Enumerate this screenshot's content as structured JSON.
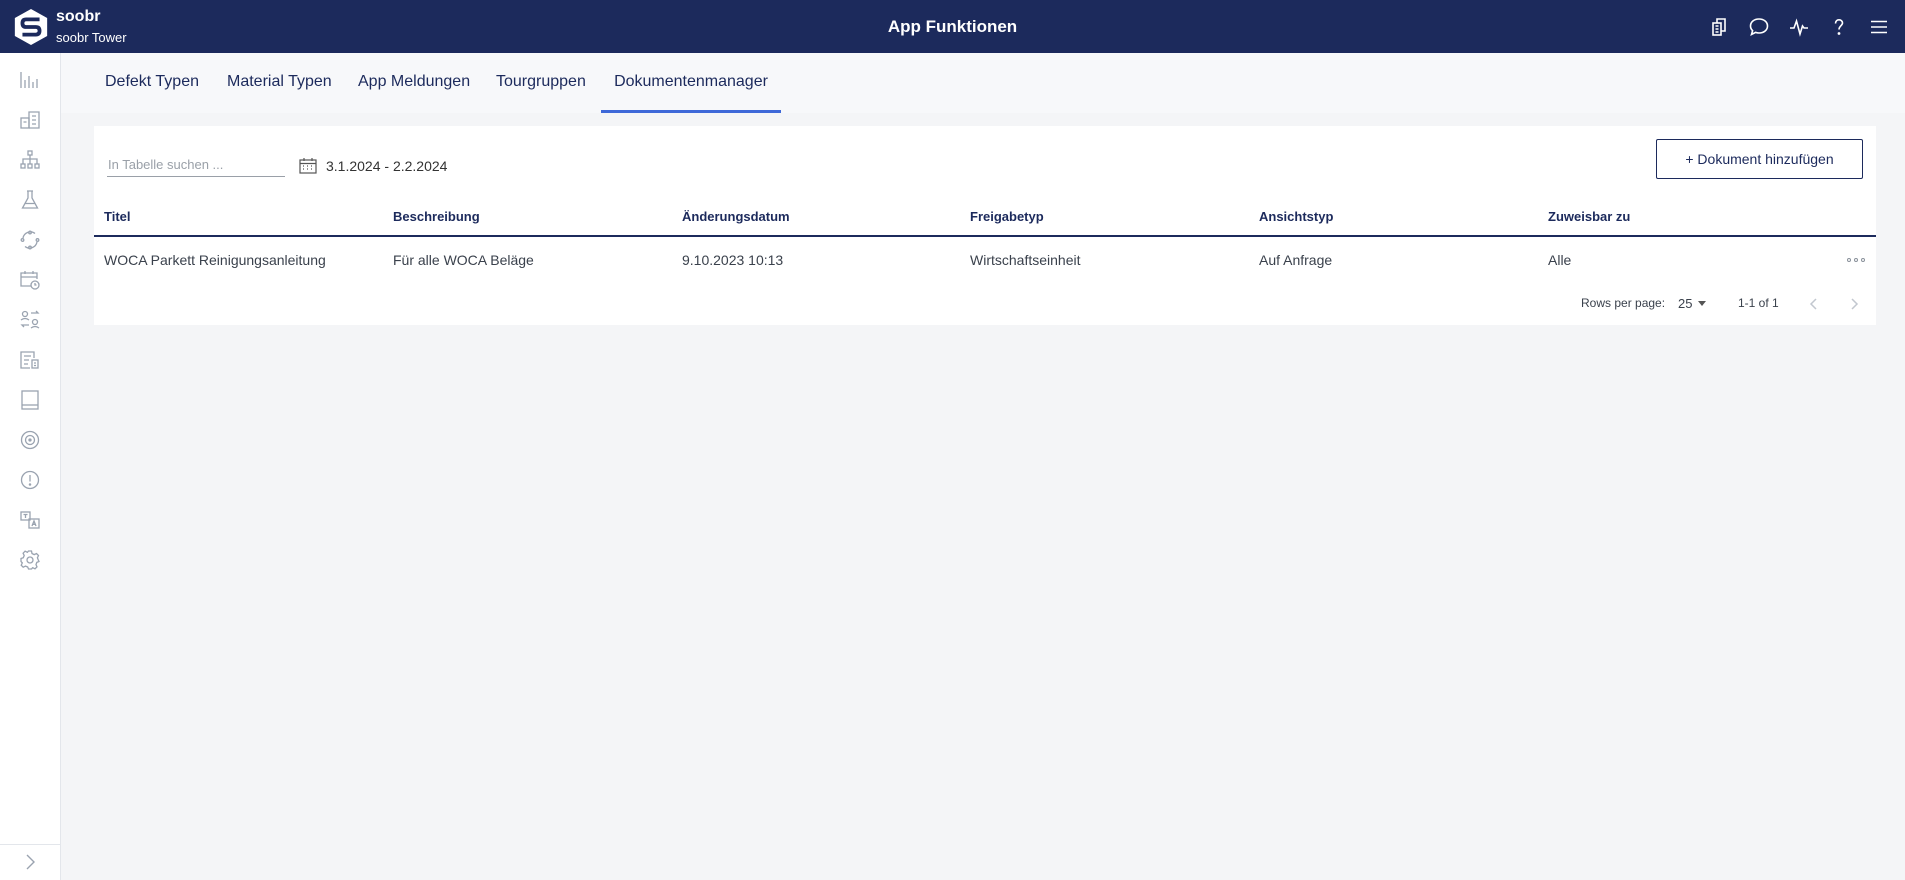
{
  "header": {
    "brand_name": "soobr",
    "brand_sub": "soobr Tower",
    "title": "App Funktionen",
    "icons": [
      "buildings-icon",
      "chat-icon",
      "activity-icon",
      "help-icon",
      "menu-icon"
    ]
  },
  "sidebar": {
    "items": [
      "analytics-icon",
      "buildings-icon",
      "hierarchy-icon",
      "flask-icon",
      "cycle-icon",
      "calendar-clock-icon",
      "user-swap-icon",
      "document-building-icon",
      "book-icon",
      "target-icon",
      "alert-icon",
      "translate-icon",
      "settings-icon"
    ],
    "expand_icon": "chevron-right-icon"
  },
  "tabs": [
    {
      "label": "Defekt Typen"
    },
    {
      "label": "Material Typen"
    },
    {
      "label": "App Meldungen"
    },
    {
      "label": "Tourgruppen"
    },
    {
      "label": "Dokumentenmanager",
      "active": true
    }
  ],
  "toolbar": {
    "search_placeholder": "In Tabelle suchen ...",
    "date_range": "3.1.2024 - 2.2.2024",
    "add_button": "+ Dokument hinzufügen"
  },
  "table": {
    "columns": [
      "Titel",
      "Beschreibung",
      "Änderungsdatum",
      "Freigabetyp",
      "Ansichtstyp",
      "Zuweisbar zu"
    ],
    "rows": [
      [
        "WOCA Parkett Reinigungsanleitung",
        "Für alle WOCA Beläge",
        "9.10.2023 10:13",
        "Wirtschaftseinheit",
        "Auf Anfrage",
        "Alle"
      ]
    ]
  },
  "pagination": {
    "rows_per_page_label": "Rows per page:",
    "rows_per_page": "25",
    "range": "1-1 of 1"
  },
  "colors": {
    "header_bg": "#1c2a5c",
    "accent": "#3e68d8",
    "page_bg": "#f4f5f7"
  }
}
